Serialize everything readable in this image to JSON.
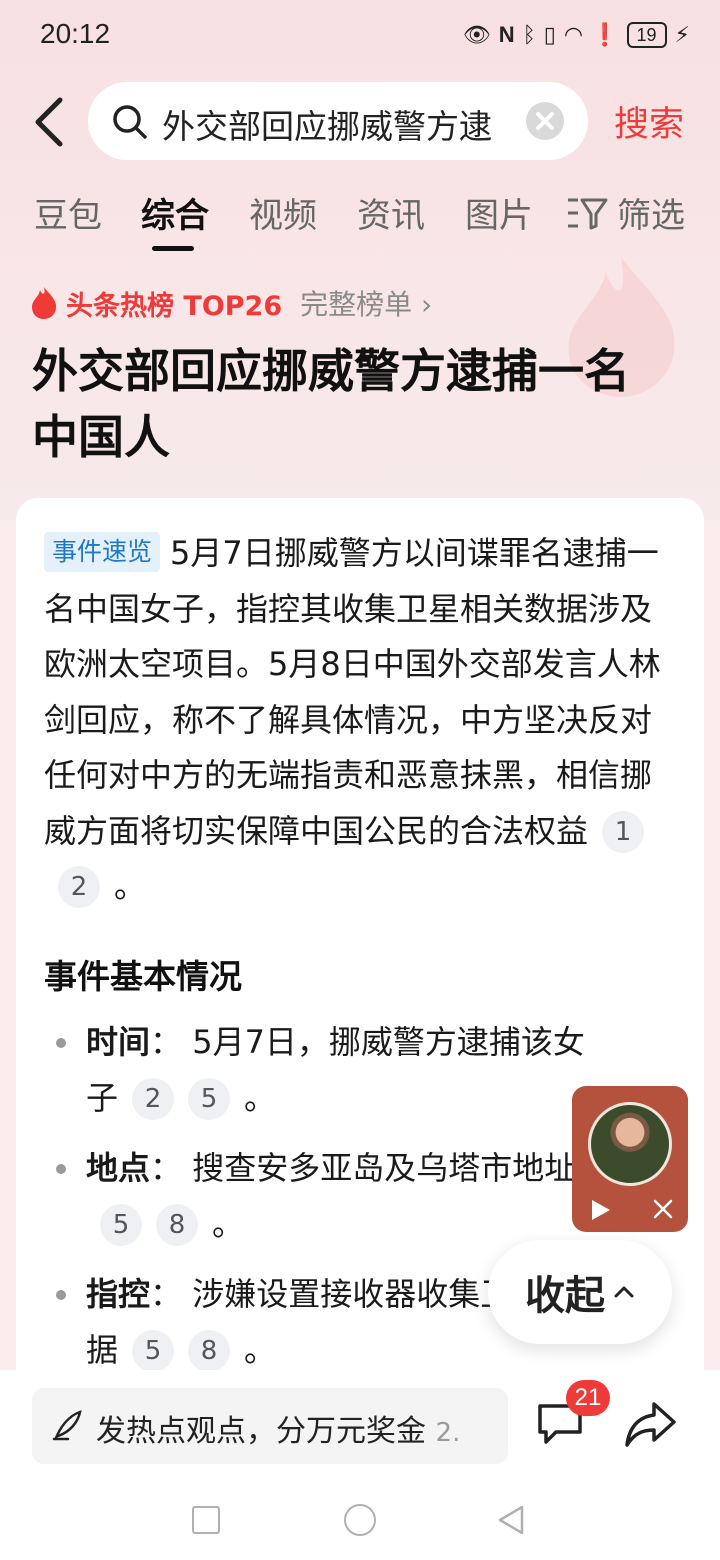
{
  "status_bar": {
    "time": "20:12",
    "battery": "19"
  },
  "search": {
    "query": "外交部回应挪威警方逮",
    "submit_label": "搜索"
  },
  "tabs": [
    {
      "label": "豆包"
    },
    {
      "label": "综合",
      "active": true
    },
    {
      "label": "视频"
    },
    {
      "label": "资讯"
    },
    {
      "label": "图片"
    },
    {
      "label": "筛选"
    }
  ],
  "hot_rank": {
    "label": "头条热榜 TOP26",
    "full_list": "完整榜单 ›"
  },
  "headline": "外交部回应挪威警方逮捕一名中国人",
  "summary": {
    "tag": "事件速览",
    "text": "5月7日挪威警方以间谍罪名逮捕一名中国女子，指控其收集卫星相关数据涉及欧洲太空项目。5月8日中国外交部发言人林剑回应，称不了解具体情况，中方坚决反对任何对中方的无端指责和恶意抹黑，相信挪威方面将切实保障中国公民的合法权益",
    "refs": [
      "1",
      "2"
    ],
    "end": "。"
  },
  "section": {
    "title": "事件基本情况",
    "items": [
      {
        "key": "时间",
        "sep": "：",
        "text": "5月7日，挪威警方逮捕该女子",
        "refs": [
          "2",
          "5"
        ],
        "end": "。"
      },
      {
        "key": "地点",
        "sep": "：",
        "text": "搜查安多亚岛及乌塔市地址",
        "refs": [
          "5",
          "8"
        ],
        "end": "。"
      },
      {
        "key": "指控",
        "sep": "：",
        "text": "涉嫌设置接收器收集卫星数据",
        "refs": [
          "5",
          "8"
        ],
        "end": "。"
      }
    ]
  },
  "collapse": {
    "label": "收起"
  },
  "bottom": {
    "comment_placeholder": "发热点观点，分万元奖金",
    "comment_suffix": "2.",
    "comment_count": "21"
  },
  "colors": {
    "accent": "#ef3a3a",
    "tag_blue": "#1f77c8"
  }
}
